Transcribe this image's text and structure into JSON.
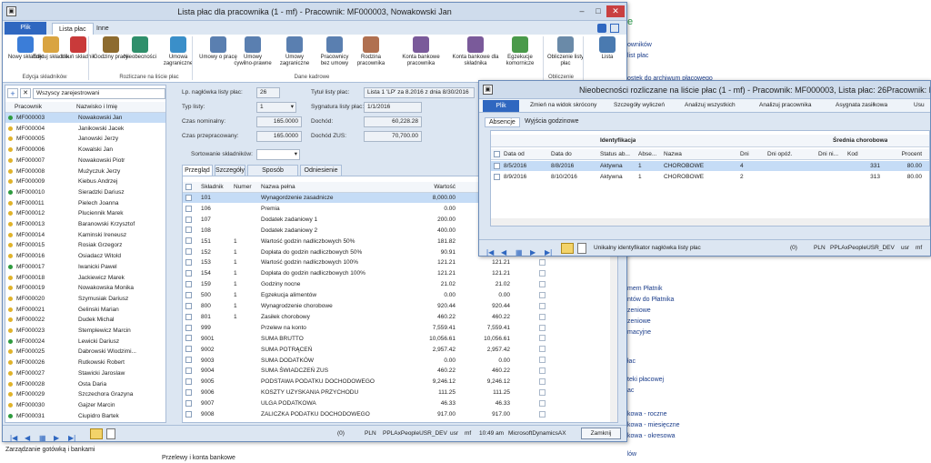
{
  "background": {
    "nav_items": [
      "e",
      "owników",
      "list płac",
      "ostek do archiwum płacowego",
      "ów płacowych",
      "o listy płac",
      "o listy płac",
      "mem Płatnik",
      "ntów do Płatnika",
      "zeniowe",
      "zeniowe",
      "macyjne",
      "łac",
      "teki płacowej",
      "ac",
      "kowa - roczne",
      "kowa - miesięczne",
      "kowa - okresowa",
      "Karta przychodów"
    ],
    "bottom_items": [
      "Zarządzanie gotówką i bankami",
      "Przelewy i konta bankowe"
    ]
  },
  "main": {
    "title": "Lista płac dla pracownika (1 - mf) - Pracownik: MF000003, Nowakowski Jan",
    "file_tab": "Plik",
    "tabs": [
      "Lista płac",
      "Inne"
    ],
    "ribbon": {
      "buttons": [
        {
          "label": "Nowy składnik"
        },
        {
          "label": "Edytuj składnik"
        },
        {
          "label": "Usuń składnik"
        },
        {
          "label": "Godziny pracy"
        },
        {
          "label": "Nieobecności"
        },
        {
          "label": "Umowa zagraniczne"
        },
        {
          "label": "Umowy o pracę"
        },
        {
          "label": "Umowy cywilno-prawne"
        },
        {
          "label": "Umowy zagraniczne"
        },
        {
          "label": "Pracownicy bez umowy"
        },
        {
          "label": "Rodzina pracownika"
        },
        {
          "label": "Konta bankowe pracownika"
        },
        {
          "label": "Konta bankowe dla składnika"
        },
        {
          "label": "Egzekucje komornicze"
        },
        {
          "label": "Obliczenie listy płac"
        },
        {
          "label": "Lista"
        }
      ],
      "groups": [
        "Edycja składników",
        "Rozliczane na liście płac",
        "Dane kadrowe",
        "Obliczenie"
      ]
    },
    "filter_value": "Wszyscy zarejestrowani",
    "emp_headers": {
      "id": "Pracownik",
      "name": "Nazwisko i Imię"
    },
    "employees": [
      {
        "id": "MF000003",
        "name": "Nowakowski Jan"
      },
      {
        "id": "MF000004",
        "name": "Janikowski Jacek"
      },
      {
        "id": "MF000005",
        "name": "Janowski Jerzy"
      },
      {
        "id": "MF000006",
        "name": "Kowalski Jan"
      },
      {
        "id": "MF000007",
        "name": "Nowakowski Piotr"
      },
      {
        "id": "MF000008",
        "name": "Mużyczuk Jerzy"
      },
      {
        "id": "MF000009",
        "name": "Kiebus Andrzej"
      },
      {
        "id": "MF000010",
        "name": "Sieradzki Dariusz"
      },
      {
        "id": "MF000011",
        "name": "Pielech Joanna"
      },
      {
        "id": "MF000012",
        "name": "Pluciennik Marek"
      },
      {
        "id": "MF000013",
        "name": "Baranowski Krzysztof"
      },
      {
        "id": "MF000014",
        "name": "Kaminski Ireneusz"
      },
      {
        "id": "MF000015",
        "name": "Rosiak Grzegorz"
      },
      {
        "id": "MF000016",
        "name": "Osiadacz Witold"
      },
      {
        "id": "MF000017",
        "name": "Iwanicki Pawel"
      },
      {
        "id": "MF000018",
        "name": "Jackiewicz Marek"
      },
      {
        "id": "MF000019",
        "name": "Nowakowska Monika"
      },
      {
        "id": "MF000020",
        "name": "Szymusiak Dariusz"
      },
      {
        "id": "MF000021",
        "name": "Gelinski Marian"
      },
      {
        "id": "MF000022",
        "name": "Dudek Michal"
      },
      {
        "id": "MF000023",
        "name": "Stemplewicz Marcin"
      },
      {
        "id": "MF000024",
        "name": "Lewicki Dariusz"
      },
      {
        "id": "MF000025",
        "name": "Dabrowski Wlodzimi..."
      },
      {
        "id": "MF000026",
        "name": "Rutkowski Robert"
      },
      {
        "id": "MF000027",
        "name": "Stawicki Jaroslaw"
      },
      {
        "id": "MF000028",
        "name": "Osta Daria"
      },
      {
        "id": "MF000029",
        "name": "Szczechora Grazyna"
      },
      {
        "id": "MF000030",
        "name": "Gajzer Marcin"
      },
      {
        "id": "MF000031",
        "name": "Ciupidro Bartek"
      }
    ],
    "form": {
      "lp_label": "Lp. nagłówka listy płac:",
      "lp_value": "26",
      "title_label": "Tytuł listy płac:",
      "title_value": "Lista 1 'LP' za 8.2016 z dnia 8/30/2016",
      "type_label": "Typ listy:",
      "type_value": "1",
      "sig_label": "Sygnatura listy płac:",
      "sig_value": "1/1/2016",
      "nominal_label": "Czas nominalny:",
      "nominal_value": "165.0000",
      "income_label": "Dochód:",
      "income_value": "60,228.28",
      "worked_label": "Czas przepracowany:",
      "worked_value": "165.0000",
      "zus_label": "Dochód ZUS:",
      "zus_value": "70,700.00",
      "sort_label": "Sortowanie składników:"
    },
    "subtabs": [
      "Przegląd",
      "Szczegóły",
      "Sposób obliczenia",
      "Odniesienie"
    ],
    "comp_headers": {
      "code": "Składnik",
      "number": "Numer",
      "name": "Nazwa pełna",
      "value": "Wartość"
    },
    "components": [
      {
        "code": "101",
        "number": "",
        "name": "Wynagordzenie zasadnicze",
        "value": "8,000.00",
        "value2": ""
      },
      {
        "code": "106",
        "number": "",
        "name": "Premia",
        "value": "0.00",
        "value2": ""
      },
      {
        "code": "107",
        "number": "",
        "name": "Dodatek zadaniowy 1",
        "value": "200.00",
        "value2": ""
      },
      {
        "code": "108",
        "number": "",
        "name": "Dodatek zadaniowy 2",
        "value": "400.00",
        "value2": ""
      },
      {
        "code": "151",
        "number": "1",
        "name": "Wartość godzin nadliczbowych 50%",
        "value": "181.82",
        "value2": ""
      },
      {
        "code": "152",
        "number": "1",
        "name": "Dopłata do godzin nadliczbowych 50%",
        "value": "90.91",
        "value2": ""
      },
      {
        "code": "153",
        "number": "1",
        "name": "Wartość godzin nadliczbowych 100%",
        "value": "121.21",
        "value2": "121.21"
      },
      {
        "code": "154",
        "number": "1",
        "name": "Dopłata do godzin nadliczbowych 100%",
        "value": "121.21",
        "value2": "121.21"
      },
      {
        "code": "159",
        "number": "1",
        "name": "Godziny nocne",
        "value": "21.02",
        "value2": "21.02"
      },
      {
        "code": "500",
        "number": "1",
        "name": "Egzekucja alimentów",
        "value": "0.00",
        "value2": "0.00"
      },
      {
        "code": "800",
        "number": "1",
        "name": "Wynagrodzenie chorobowe",
        "value": "920.44",
        "value2": "920.44"
      },
      {
        "code": "801",
        "number": "1",
        "name": "Zasiłek chorobowy",
        "value": "460.22",
        "value2": "460.22"
      },
      {
        "code": "999",
        "number": "",
        "name": "Przelew na konto",
        "value": "7,559.41",
        "value2": "7,559.41"
      },
      {
        "code": "9001",
        "number": "",
        "name": "SUMA BRUTTO",
        "value": "10,056.61",
        "value2": "10,056.61"
      },
      {
        "code": "9002",
        "number": "",
        "name": "SUMA POTRĄCEŃ",
        "value": "2,957.42",
        "value2": "2,957.42"
      },
      {
        "code": "9003",
        "number": "",
        "name": "SUMA DODATKÓW",
        "value": "0.00",
        "value2": "0.00"
      },
      {
        "code": "9004",
        "number": "",
        "name": "SUMA ŚWIADCZEŃ ZUS",
        "value": "460.22",
        "value2": "460.22"
      },
      {
        "code": "9005",
        "number": "",
        "name": "PODSTAWA PODATKU DOCHODOWEGO",
        "value": "9,246.12",
        "value2": "9,246.12"
      },
      {
        "code": "9006",
        "number": "",
        "name": "KOSZTY UZYSKANIA PRZYCHODU",
        "value": "111.25",
        "value2": "111.25"
      },
      {
        "code": "9007",
        "number": "",
        "name": "ULGA PODATKOWA",
        "value": "46.33",
        "value2": "46.33"
      },
      {
        "code": "9008",
        "number": "",
        "name": "ZALICZKA PODATKU DOCHODOWEGO",
        "value": "917.00",
        "value2": "917.00"
      }
    ],
    "status": {
      "count": "(0)",
      "currency": "PLN",
      "company": "PPLAxPeopleUSR_DEV",
      "user": "usr",
      "mf": "mf",
      "time": "10:49 am",
      "app": "MicrosoftDynamicsAX",
      "close": "Zamknij"
    }
  },
  "popup": {
    "title": "Nieobecności rozliczane na liście płac (1 - mf) - Pracownik: MF000003, Lista płac: 26Pracownik: M",
    "file_tab": "Plik",
    "toolbar": [
      "Zmień na widok skrócony",
      "Szczegóły wyliczeń",
      "Analizuj wszystkich",
      "Analizuj pracownika",
      "Asygnata zasiłkowa",
      "Usu"
    ],
    "tabs": [
      "Absencje",
      "Wyjścia godzinowe"
    ],
    "group_headers": [
      "Identyfikacja",
      "Średnia chorobowa"
    ],
    "headers": [
      "Data od",
      "Data do",
      "Status ab...",
      "Abse...",
      "Nazwa",
      "Dni",
      "Dni opóź.",
      "Dni ni...",
      "Kod",
      "Procent"
    ],
    "rows": [
      [
        "8/5/2016",
        "8/8/2016",
        "Aktywna",
        "1",
        "CHOROBOWE",
        "4",
        "",
        "",
        "331",
        "80.00"
      ],
      [
        "8/9/2016",
        "8/10/2016",
        "Aktywna",
        "1",
        "CHOROBOWE",
        "2",
        "",
        "",
        "313",
        "80.00"
      ]
    ],
    "status": {
      "hint": "Unikalny identyfikator nagłówka listy płac",
      "count": "(0)",
      "currency": "PLN",
      "company": "PPLAxPeopleUSR_DEV",
      "user": "usr",
      "mf": "mf"
    }
  }
}
